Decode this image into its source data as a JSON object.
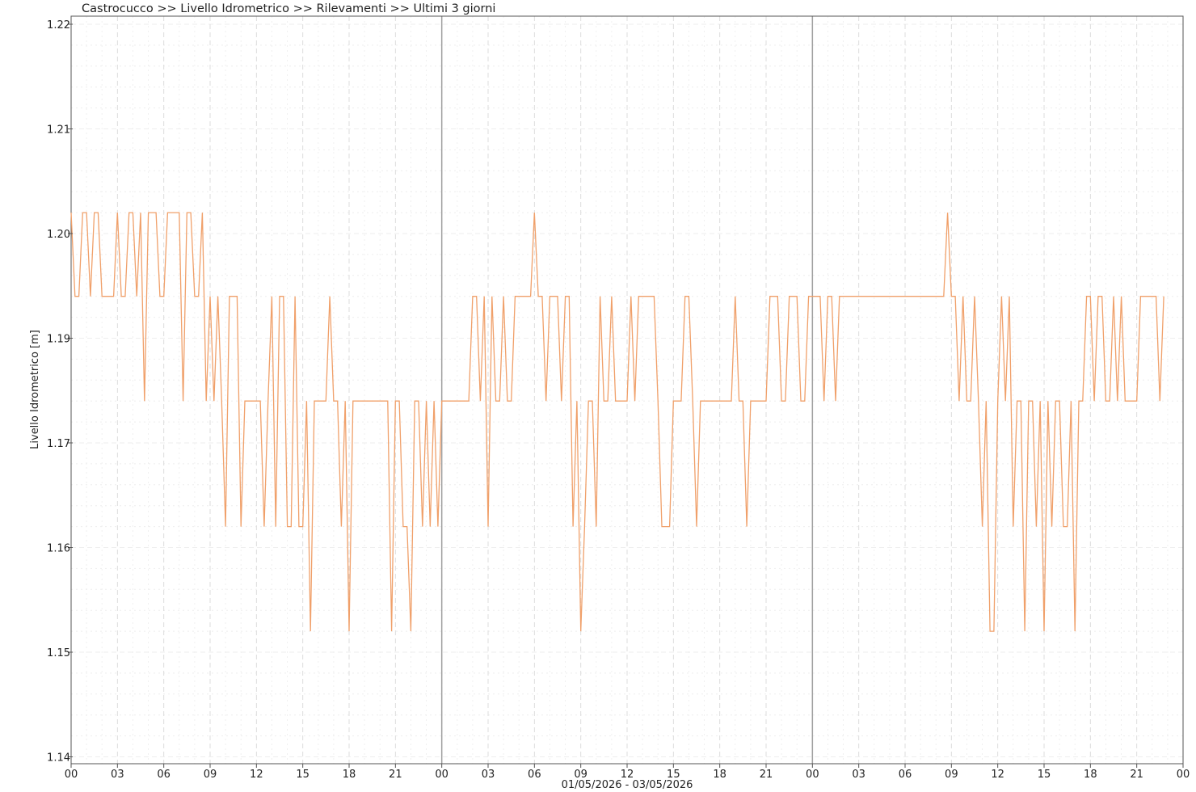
{
  "chart_data": {
    "type": "line",
    "title": "Castrocucco >> Livello Idrometrico >> Rilevamenti >> Ultimi 3 giorni",
    "ylabel": "Livello Idrometrico [m]",
    "xlabel": "01/05/2026 - 03/05/2026",
    "ylim": [
      1.14,
      1.22
    ],
    "xlim_hours": [
      0,
      72
    ],
    "grid": true,
    "colors": {
      "series": "#f0a06a",
      "day_divider": "#a0a0a0",
      "grid": "#dddddd",
      "axis": "#555555"
    },
    "y_ticks": [
      "1.14",
      "1.15",
      "1.16",
      "1.17",
      "1.19",
      "1.20",
      "1.21",
      "1.22"
    ],
    "y_tick_values": [
      1.14,
      1.15,
      1.16,
      1.17,
      1.19,
      1.2,
      1.21,
      1.22
    ],
    "x_ticks": [
      "00",
      "03",
      "06",
      "09",
      "12",
      "15",
      "18",
      "21",
      "00",
      "03",
      "06",
      "09",
      "12",
      "15",
      "18",
      "21",
      "00",
      "03",
      "06",
      "09",
      "12",
      "15",
      "18",
      "21",
      "00"
    ],
    "day_dividers_hours": [
      24,
      48
    ],
    "series": [
      {
        "x_hours": [
          0,
          0.25,
          0.5,
          0.75,
          1,
          1.25,
          1.5,
          1.75,
          2,
          2.25,
          2.5,
          2.75,
          3,
          3.25,
          3.5,
          3.75,
          4,
          4.25,
          4.5,
          4.75,
          5,
          5.25,
          5.5,
          5.75,
          6,
          6.25,
          6.5,
          6.75,
          7,
          7.25,
          7.5,
          7.75,
          8,
          8.25,
          8.5,
          8.75,
          9,
          9.25,
          9.5,
          9.75,
          10,
          10.25,
          10.5,
          10.75,
          11,
          11.25,
          11.5,
          11.75,
          12,
          12.25,
          12.5,
          12.75,
          13,
          13.25,
          13.5,
          13.75,
          14,
          14.25,
          14.5,
          14.75,
          15,
          15.25,
          15.5,
          15.75,
          16,
          16.25,
          16.5,
          16.75,
          17,
          17.25,
          17.5,
          17.75,
          18,
          18.25,
          18.5,
          18.75,
          19,
          19.25,
          19.5,
          19.75,
          20,
          20.25,
          20.5,
          20.75,
          21,
          21.25,
          21.5,
          21.75,
          22,
          22.25,
          22.5,
          22.75,
          23,
          23.25,
          23.5,
          23.75,
          24,
          24.25,
          24.5,
          24.75,
          25,
          25.25,
          25.5,
          25.75,
          26,
          26.25,
          26.5,
          26.75,
          27,
          27.25,
          27.5,
          27.75,
          28,
          28.25,
          28.5,
          28.75,
          29,
          29.25,
          29.5,
          29.75,
          30,
          30.25,
          30.5,
          30.75,
          31,
          31.25,
          31.5,
          31.75,
          32,
          32.25,
          32.5,
          32.75,
          33,
          33.25,
          33.5,
          33.75,
          34,
          34.25,
          34.5,
          34.75,
          35,
          35.25,
          35.5,
          35.75,
          36,
          36.25,
          36.5,
          36.75,
          37,
          37.25,
          37.5,
          37.75,
          38,
          38.25,
          38.5,
          38.75,
          39,
          39.25,
          39.5,
          39.75,
          40,
          40.25,
          40.5,
          40.75,
          41,
          41.25,
          41.5,
          41.75,
          42,
          42.25,
          42.5,
          42.75,
          43,
          43.25,
          43.5,
          43.75,
          44,
          44.25,
          44.5,
          44.75,
          45,
          45.25,
          45.5,
          45.75,
          46,
          46.25,
          46.5,
          46.75,
          47,
          47.25,
          47.5,
          47.75,
          48,
          48.25,
          48.5,
          48.75,
          49,
          49.25,
          49.5,
          49.75,
          50,
          50.25,
          50.5,
          50.75,
          51,
          51.25,
          51.5,
          51.75,
          52,
          52.25,
          52.5,
          52.75,
          53,
          53.25,
          53.5,
          53.75,
          54,
          54.25,
          54.5,
          54.75,
          55,
          55.25,
          55.5,
          55.75,
          56,
          56.25,
          56.5,
          56.75,
          57,
          57.25,
          57.5,
          57.75,
          58,
          58.25,
          58.5,
          58.75,
          59,
          59.25,
          59.5,
          59.75,
          60,
          60.25,
          60.5,
          60.75,
          61,
          61.25,
          61.5,
          61.75,
          62,
          62.25,
          62.5,
          62.75,
          63,
          63.25,
          63.5,
          63.75,
          64,
          64.25,
          64.5,
          64.75,
          65,
          65.25,
          65.5,
          65.75,
          66,
          66.25,
          66.5,
          66.75,
          67,
          67.25,
          67.5,
          67.75,
          68,
          68.25,
          68.5,
          68.75,
          69,
          69.25,
          69.5,
          69.75,
          70,
          70.25,
          70.5,
          70.75,
          71,
          71.25,
          71.5,
          71.75,
          72
        ],
        "values": [
          1.202,
          1.194,
          1.194,
          1.202,
          1.202,
          1.194,
          1.202,
          1.202,
          1.194,
          1.194,
          1.194,
          1.194,
          1.202,
          1.194,
          1.194,
          1.202,
          1.202,
          1.194,
          1.202,
          1.184,
          1.202,
          1.202,
          1.202,
          1.194,
          1.194,
          1.202,
          1.202,
          1.202,
          1.202,
          1.184,
          1.202,
          1.202,
          1.194,
          1.194,
          1.202,
          1.184,
          1.194,
          1.184,
          1.194,
          1.184,
          1.172,
          1.194,
          1.194,
          1.194,
          1.172,
          1.184,
          1.184,
          1.184,
          1.184,
          1.184,
          1.172,
          1.184,
          1.194,
          1.172,
          1.194,
          1.194,
          1.172,
          1.172,
          1.194,
          1.172,
          1.172,
          1.184,
          1.162,
          1.184,
          1.184,
          1.184,
          1.184,
          1.194,
          1.184,
          1.184,
          1.172,
          1.184,
          1.162,
          1.184,
          1.184,
          1.184,
          1.184,
          1.184,
          1.184,
          1.184,
          1.184,
          1.184,
          1.184,
          1.162,
          1.184,
          1.184,
          1.172,
          1.172,
          1.162,
          1.184,
          1.184,
          1.172,
          1.184,
          1.172,
          1.184,
          1.172,
          1.184,
          1.184,
          1.184,
          1.184,
          1.184,
          1.184,
          1.184,
          1.184,
          1.194,
          1.194,
          1.184,
          1.194,
          1.172,
          1.194,
          1.184,
          1.184,
          1.194,
          1.184,
          1.184,
          1.194,
          1.194,
          1.194,
          1.194,
          1.194,
          1.202,
          1.194,
          1.194,
          1.184,
          1.194,
          1.194,
          1.194,
          1.184,
          1.194,
          1.194,
          1.172,
          1.184,
          1.162,
          1.172,
          1.184,
          1.184,
          1.172,
          1.194,
          1.184,
          1.184,
          1.194,
          1.184,
          1.184,
          1.184,
          1.184,
          1.194,
          1.184,
          1.194,
          1.194,
          1.194,
          1.194,
          1.194,
          1.184,
          1.172,
          1.172,
          1.172,
          1.184,
          1.184,
          1.184,
          1.194,
          1.194,
          1.184,
          1.172,
          1.184,
          1.184,
          1.184,
          1.184,
          1.184,
          1.184,
          1.184,
          1.184,
          1.184,
          1.194,
          1.184,
          1.184,
          1.172,
          1.184,
          1.184,
          1.184,
          1.184,
          1.184,
          1.194,
          1.194,
          1.194,
          1.184,
          1.184,
          1.194,
          1.194,
          1.194,
          1.184,
          1.184,
          1.194,
          1.194,
          1.194,
          1.194,
          1.184,
          1.194,
          1.194,
          1.184,
          1.194,
          1.194,
          1.194,
          1.194,
          1.194,
          1.194,
          1.194,
          1.194,
          1.194,
          1.194,
          1.194,
          1.194,
          1.194,
          1.194,
          1.194,
          1.194,
          1.194,
          1.194,
          1.194,
          1.194,
          1.194,
          1.194,
          1.194,
          1.194,
          1.194,
          1.194,
          1.194,
          1.194,
          1.202,
          1.194,
          1.194,
          1.184,
          1.194,
          1.184,
          1.184,
          1.194,
          1.184,
          1.172,
          1.184,
          1.162,
          1.162,
          1.184,
          1.194,
          1.184,
          1.194,
          1.172,
          1.184,
          1.184,
          1.162,
          1.184,
          1.184,
          1.172,
          1.184,
          1.162,
          1.184,
          1.172,
          1.184,
          1.184,
          1.172,
          1.172,
          1.184,
          1.162,
          1.184,
          1.184,
          1.194,
          1.194,
          1.184,
          1.194,
          1.194,
          1.184,
          1.184,
          1.194,
          1.184,
          1.194,
          1.184,
          1.184,
          1.184,
          1.184,
          1.194,
          1.194,
          1.194,
          1.194,
          1.194,
          1.184,
          1.194
        ]
      }
    ]
  }
}
